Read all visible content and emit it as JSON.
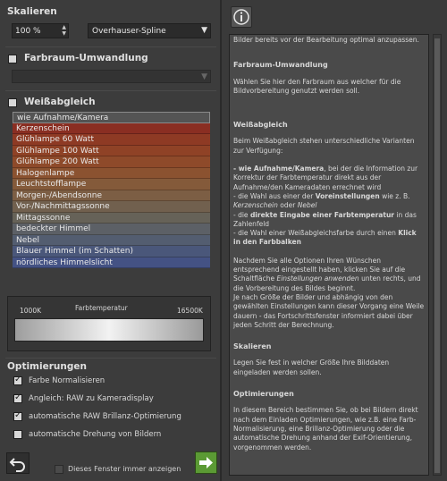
{
  "scale": {
    "header": "Skalieren",
    "percent_value": "100 %",
    "method_value": "Overhauser-Spline"
  },
  "colorspace": {
    "header": "Farbraum-Umwandlung",
    "dropdown_value": ""
  },
  "whitebalance": {
    "header": "Weißabgleich",
    "items": [
      {
        "label": "wie Aufnahme/Kamera",
        "color": "#5a5a5a"
      },
      {
        "label": "Kerzenschein",
        "color": "#8a2e22"
      },
      {
        "label": "Glühlampe 60 Watt",
        "color": "#8e3a24"
      },
      {
        "label": "Glühlampe 100 Watt",
        "color": "#8f4226"
      },
      {
        "label": "Glühlampe 200 Watt",
        "color": "#8e4a2a"
      },
      {
        "label": "Halogenlampe",
        "color": "#8b5230"
      },
      {
        "label": "Leuchtstofflampe",
        "color": "#845a3a"
      },
      {
        "label": "Morgen-/Abendsonne",
        "color": "#7c5e44"
      },
      {
        "label": "Vor-/Nachmittagssonne",
        "color": "#71604e"
      },
      {
        "label": "Mittagssonne",
        "color": "#666258"
      },
      {
        "label": "bedeckter Himmel",
        "color": "#5c6066"
      },
      {
        "label": "Nebel",
        "color": "#535d70"
      },
      {
        "label": "Blauer Himmel (im Schatten)",
        "color": "#4a577a"
      },
      {
        "label": "nördliches Himmelslicht",
        "color": "#445284"
      }
    ]
  },
  "temperature": {
    "label": "Farbtemperatur",
    "min_label": "1000K",
    "max_label": "16500K"
  },
  "optimizations": {
    "header": "Optimierungen",
    "items": [
      {
        "label": "Farbe Normalisieren",
        "checked": true
      },
      {
        "label": "Angleich: RAW zu Kameradisplay",
        "checked": true
      },
      {
        "label": "automatische RAW Brillanz-Optimierung",
        "checked": true
      },
      {
        "label": "automatische Drehung von Bildern",
        "checked": false
      }
    ]
  },
  "footer": {
    "show_always_label": "Dieses Fenster immer anzeigen"
  },
  "help": {
    "intro": "Bilder bereits vor der Bearbeitung optimal anzupassen.",
    "s1_title": "Farbraum-Umwandlung",
    "s1_text": "Wählen Sie hier den Farbraum aus welcher für die Bildvorbereitung genutzt werden soll.",
    "s2_title": "Weißabgleich",
    "s2_text": "Beim Weißabgleich stehen unterschiedliche Varianten zur Verfügung:",
    "s2_b1a": "- wie Aufnahme/Kamera",
    "s2_b1b": ", bei der die Information zur Korrektur der Farbtemperatur direkt aus der Aufnahme/den Kameradaten errechnet wird",
    "s2_b2a": "- die Wahl aus einer der ",
    "s2_b2b": "Voreinstellungen",
    "s2_b2c": " wie z. B. ",
    "s2_b2d": "Kerzenschein",
    "s2_b2e": " oder ",
    "s2_b2f": "Nebel",
    "s2_b3a": "- die ",
    "s2_b3b": "direkte Eingabe einer Farbtemperatur",
    "s2_b3c": " in das Zahlenfeld",
    "s2_b4a": "- die Wahl einer Weißabgleichsfarbe durch einen ",
    "s2_b4b": "Klick in den Farbbalken",
    "s2_p2a": "Nachdem Sie alle Optionen Ihren Wünschen entsprechend eingestellt haben, klicken Sie auf die Schaltfläche ",
    "s2_p2b": "Einstellungen anwenden",
    "s2_p2c": " unten rechts, und die Vorbereitung des Bildes beginnt.",
    "s2_p3": "Je nach Größe der Bilder und abhängig von den gewählten Einstellungen kann dieser Vorgang eine Weile dauern - das Fortschrittsfenster informiert dabei über jeden Schritt der Berechnung.",
    "s3_title": "Skalieren",
    "s3_text": "Legen Sie fest in welcher Größe Ihre Bilddaten eingeladen werden sollen.",
    "s4_title": "Optimierungen",
    "s4_text": "In diesem Bereich bestimmen Sie, ob bei Bildern direkt nach dem Einladen Optimierungen, wie z.B. eine Farb-Normalisierung, eine Brillanz-Optimierung oder die automatische Drehung anhand der Exif-Orientierung, vorgenommen werden."
  }
}
